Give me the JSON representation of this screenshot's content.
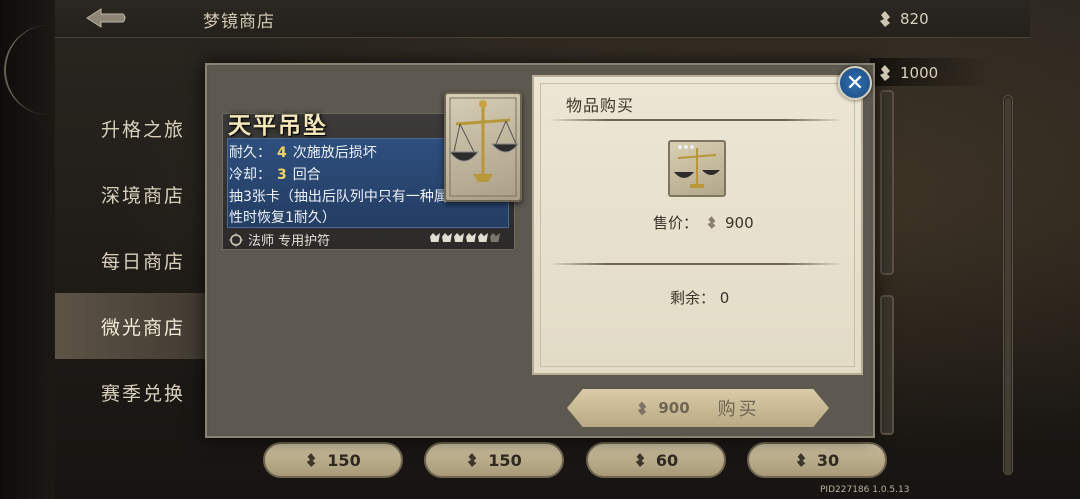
{
  "header": {
    "store_title": "梦镜商店",
    "currency_primary": "820",
    "currency_secondary": "1000"
  },
  "sidebar": {
    "items": [
      {
        "label": "升格之旅",
        "active": false
      },
      {
        "label": "深境商店",
        "active": false
      },
      {
        "label": "每日商店",
        "active": false
      },
      {
        "label": "微光商店",
        "active": true
      },
      {
        "label": "赛季兑换",
        "active": false
      }
    ]
  },
  "shop_prices": [
    "150",
    "150",
    "60",
    "30"
  ],
  "item": {
    "name": "天平吊坠",
    "durability_label": "耐久：",
    "durability_value": "4",
    "durability_suffix": "次施放后损坏",
    "cooldown_label": "冷却：",
    "cooldown_value": "3",
    "cooldown_suffix": "回合",
    "effect_line1": "抽3张卡（抽出后队列中只有一种属",
    "effect_line2": "性时恢复1耐久）",
    "class_label": "法师 专用护符",
    "rating": {
      "filled": 5,
      "total": 6
    }
  },
  "purchase": {
    "title": "物品购买",
    "price_label": "售价：",
    "price_value": "900",
    "remaining_label": "剩余：",
    "remaining_value": "0",
    "buy_amount": "900",
    "buy_label": "购买"
  },
  "footer": {
    "build": "PID227186  1.0.5.13"
  },
  "colors": {
    "accent": "#2f6fb0",
    "highlight": "#f1d262",
    "card_blue": "#2e4f7e"
  }
}
